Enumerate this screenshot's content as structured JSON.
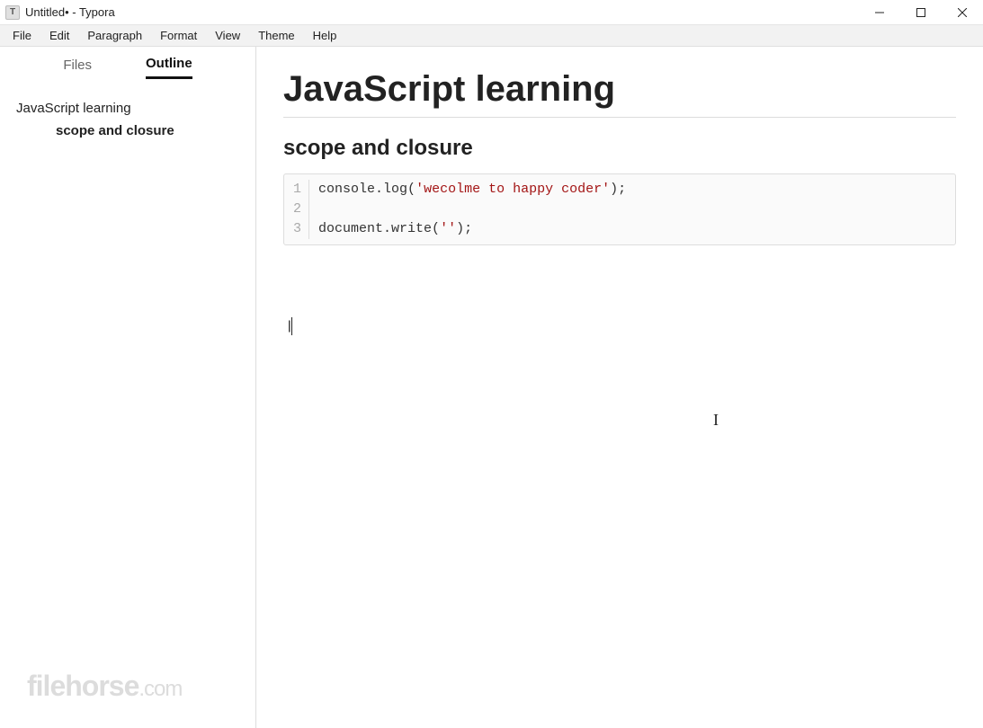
{
  "window": {
    "title": "Untitled• - Typora",
    "app_initial": "T"
  },
  "menu": {
    "items": [
      "File",
      "Edit",
      "Paragraph",
      "Format",
      "View",
      "Theme",
      "Help"
    ]
  },
  "sidebar": {
    "tabs": {
      "files": "Files",
      "outline": "Outline"
    },
    "active_tab": "outline",
    "outline": [
      {
        "label": "JavaScript learning",
        "level": 1
      },
      {
        "label": "scope and closure",
        "level": 2
      }
    ]
  },
  "document": {
    "h1": "JavaScript learning",
    "h2": "scope and closure",
    "code": {
      "lines": [
        {
          "n": "1",
          "segments": [
            {
              "t": "console",
              "c": "fn"
            },
            {
              "t": ".",
              "c": "punc"
            },
            {
              "t": "log",
              "c": "fn"
            },
            {
              "t": "(",
              "c": "punc"
            },
            {
              "t": "'wecolme to happy coder'",
              "c": "str"
            },
            {
              "t": ");",
              "c": "punc"
            }
          ]
        },
        {
          "n": "2",
          "segments": []
        },
        {
          "n": "3",
          "segments": [
            {
              "t": "document",
              "c": "fn"
            },
            {
              "t": ".",
              "c": "punc"
            },
            {
              "t": "write",
              "c": "fn"
            },
            {
              "t": "(",
              "c": "punc"
            },
            {
              "t": "''",
              "c": "str"
            },
            {
              "t": ");",
              "c": "punc"
            }
          ]
        }
      ]
    },
    "caret_text": "|"
  },
  "watermark": {
    "main": "filehorse",
    "suffix": ".com"
  }
}
